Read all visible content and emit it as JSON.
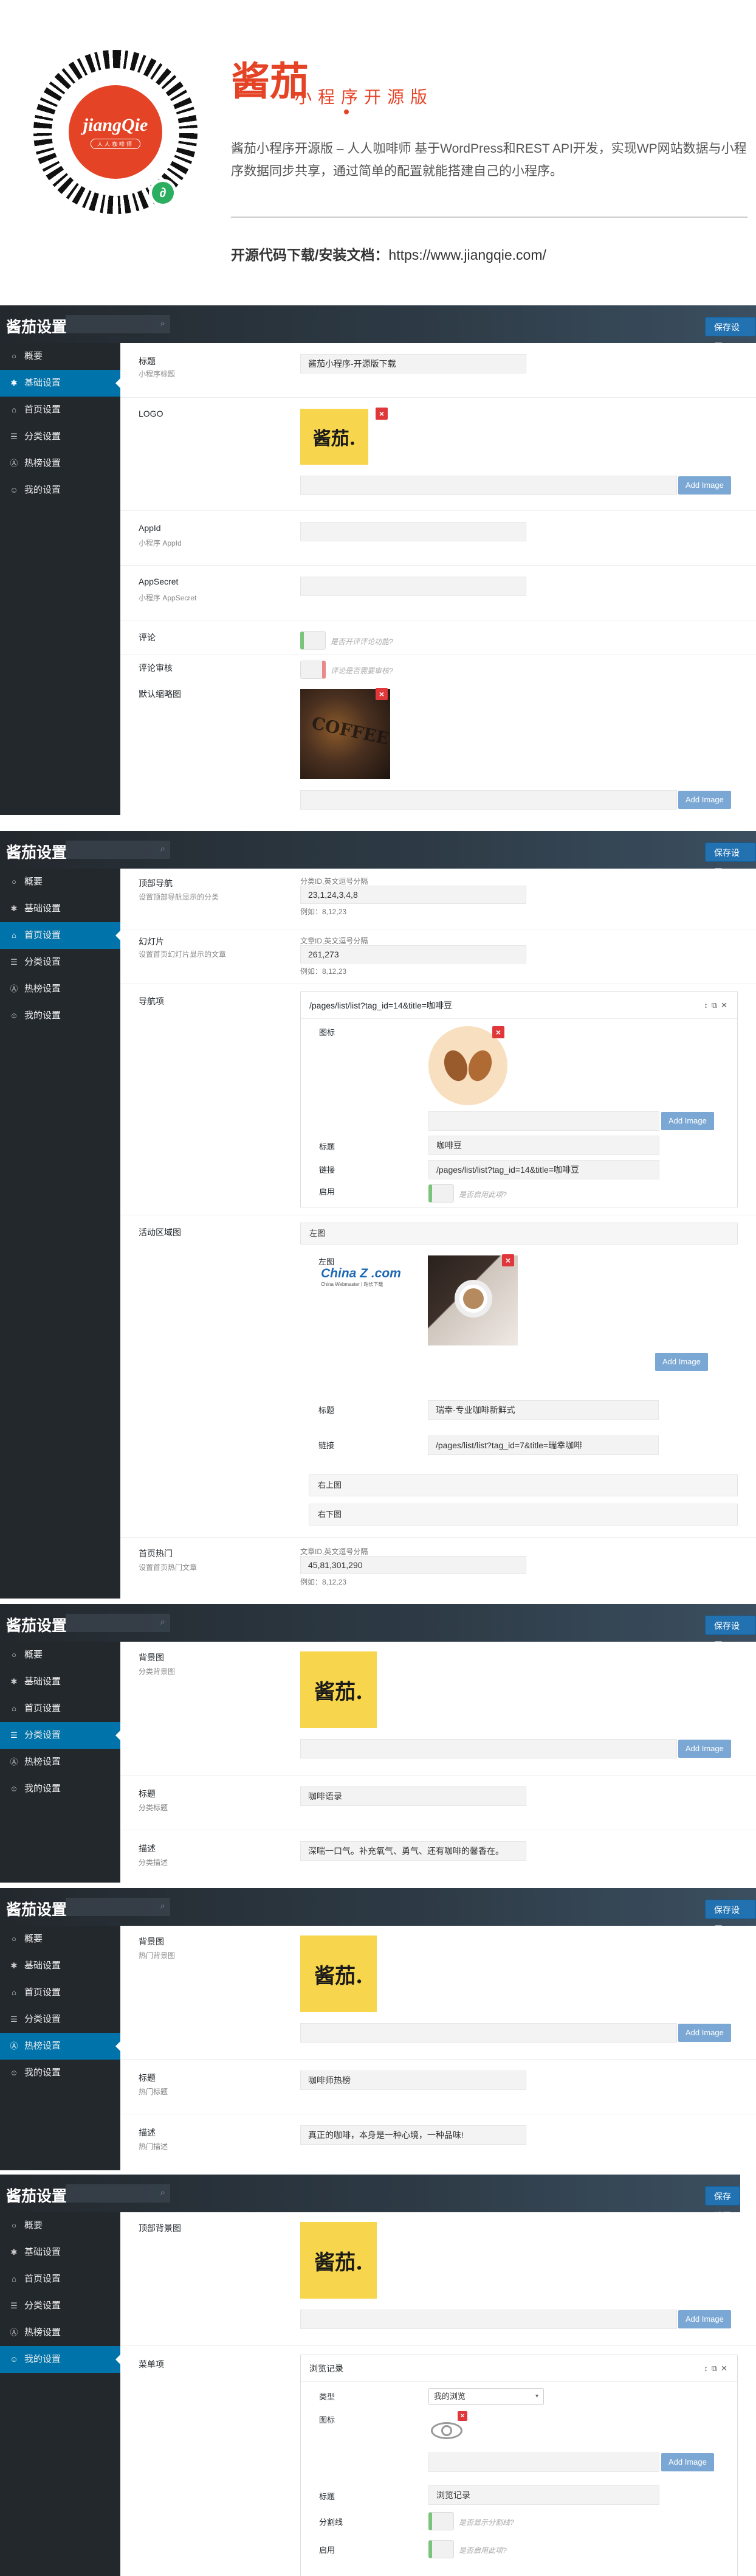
{
  "hero": {
    "qr_logo": "jiangQie",
    "qr_subtitle": "人人咖啡师",
    "brand": "酱茄",
    "brand_sub": "小程序开源版",
    "intro": "酱茄小程序开源版 – 人人咖啡师 基于WordPress和REST API开发，实现WP网站数据与小程序数据同步共享，通过简单的配置就能搭建自己的小程序。",
    "download_label": "开源代码下载/安装文档：",
    "download_url": "https://www.jiangqie.com/"
  },
  "app": {
    "title": "酱茄设置",
    "save_label": "保存设置",
    "add_image": "Add Image",
    "logo_text": "酱茄.",
    "nav": [
      {
        "label": "概要",
        "icon": "circle-icon"
      },
      {
        "label": "基础设置",
        "icon": "gear-icon"
      },
      {
        "label": "首页设置",
        "icon": "home-icon"
      },
      {
        "label": "分类设置",
        "icon": "list-icon"
      },
      {
        "label": "热榜设置",
        "icon": "flame-icon"
      },
      {
        "label": "我的设置",
        "icon": "user-icon"
      }
    ]
  },
  "basic": {
    "title_label": "标题",
    "title_sub": "小程序标题",
    "title_value": "酱茄小程序-开源版下载",
    "logo_label": "LOGO",
    "appid_label": "AppId",
    "appid_sub": "小程序 AppId",
    "secret_label": "AppSecret",
    "secret_sub": "小程序 AppSecret",
    "comment_label": "评论",
    "comment_hint": "是否开评评论功能?",
    "audit_label": "评论审核",
    "audit_hint": "评论是否需要审核?",
    "thumb_label": "默认缩略图",
    "thumb_text": "COFFEE"
  },
  "home": {
    "topnav_label": "顶部导航",
    "topnav_sub": "设置顶部导航显示的分类",
    "topnav_hint": "分类ID,英文逗号分隔",
    "topnav_value": "23,1,24,3,4,8",
    "example": "例如：8,12,23",
    "slide_label": "幻灯片",
    "slide_sub": "设置首页幻灯片显示的文章",
    "slide_hint": "文章ID,英文逗号分隔",
    "slide_value": "261,273",
    "nav_label": "导航项",
    "nav_item_title": "/pages/list/list?tag_id=14&title=咖啡豆",
    "nav_icon_label": "图标",
    "nav_title_label": "标题",
    "nav_title_value": "咖啡豆",
    "nav_link_label": "链接",
    "nav_link_value": "/pages/list/list?tag_id=14&title=咖啡豆",
    "nav_enable_label": "启用",
    "nav_enable_hint": "是否启用此项?",
    "active_label": "活动区域图",
    "left_label": "左图",
    "left_inner_label": "左图",
    "china_logo": "China Z .com",
    "china_sub": "China Webmaster | 站长下载",
    "left_title_value": "瑞幸-专业咖啡新鲜式",
    "left_link_value": "/pages/list/list?tag_id=7&title=瑞幸咖啡",
    "right_top_label": "右上图",
    "right_bottom_label": "右下图",
    "hot_label": "首页热门",
    "hot_sub": "设置首页热门文章",
    "hot_hint": "文章ID,英文逗号分隔",
    "hot_value": "45,81,301,290"
  },
  "category": {
    "bg_label": "背景图",
    "bg_sub": "分类背景图",
    "title_label": "标题",
    "title_sub": "分类标题",
    "title_value": "咖啡语录",
    "desc_label": "描述",
    "desc_sub": "分类描述",
    "desc_value": "深喘一口气。补充氧气、勇气、还有咖啡的馨香在。"
  },
  "hot": {
    "bg_label": "背景图",
    "bg_sub": "热门背景图",
    "title_label": "标题",
    "title_sub": "热门标题",
    "title_value": "咖啡师热榜",
    "desc_label": "描述",
    "desc_sub": "热门描述",
    "desc_value": "真正的咖啡，本身是一种心境，一种品味!"
  },
  "mine": {
    "bg_label": "顶部背景图",
    "menu_label": "菜单项",
    "item_title": "浏览记录",
    "type_label": "类型",
    "type_value": "我的浏览",
    "icon_label": "图标",
    "title_label": "标题",
    "title_value": "浏览记录",
    "divider_label": "分割线",
    "divider_hint": "是否显示分割线?",
    "enable_label": "启用",
    "enable_hint": "是否启用此项?"
  }
}
